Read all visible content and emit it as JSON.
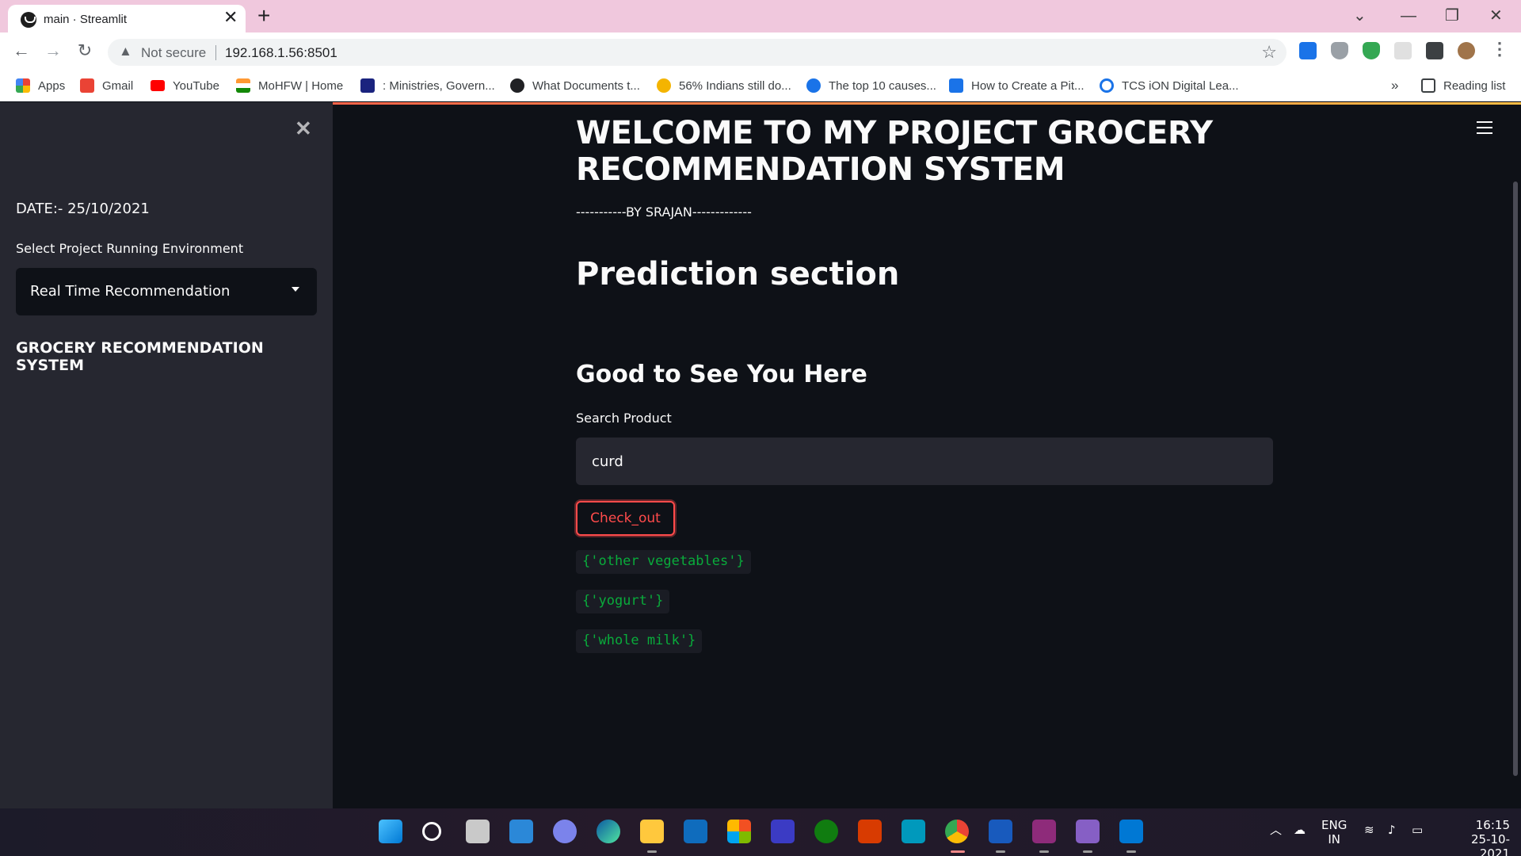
{
  "browser": {
    "tab_title": "main · Streamlit",
    "tab_close": "✕",
    "new_tab": "+",
    "address": {
      "security_label": "Not secure",
      "url": "192.168.1.56:8501"
    },
    "bookmarks": [
      {
        "label": "Apps",
        "icon": "apps-grid-icon",
        "color": "#4285f4"
      },
      {
        "label": "Gmail",
        "icon": "gmail-icon",
        "color": "#ea4335"
      },
      {
        "label": "YouTube",
        "icon": "youtube-icon",
        "color": "#ff0000"
      },
      {
        "label": "MoHFW | Home",
        "icon": "india-flag-icon",
        "color": "#ff9933"
      },
      {
        "label": ": Ministries, Govern...",
        "icon": "s-logo-icon",
        "color": "#1a237e"
      },
      {
        "label": "What Documents t...",
        "icon": "globe-icon",
        "color": "#202124"
      },
      {
        "label": "56% Indians still do...",
        "icon": "site-icon",
        "color": "#f4b400"
      },
      {
        "label": "The top 10 causes...",
        "icon": "site-icon",
        "color": "#1a73e8"
      },
      {
        "label": "How to Create a Pit...",
        "icon": "chart-icon",
        "color": "#1a73e8"
      },
      {
        "label": "TCS iON Digital Lea...",
        "icon": "power-icon",
        "color": "#1a73e8"
      }
    ],
    "bookmarks_more": "»",
    "reading_list": "Reading list"
  },
  "sidebar": {
    "date": "DATE:- 25/10/2021",
    "select_label": "Select Project Running Environment",
    "select_value": "Real Time Recommendation",
    "heading": "GROCERY RECOMMENDATION SYSTEM"
  },
  "main": {
    "title": "WELCOME TO MY PROJECT GROCERY RECOMMENDATION SYSTEM",
    "byline": "-----------BY SRAJAN-------------",
    "section_heading": "Prediction section",
    "subheading": "Good to See You Here",
    "search_label": "Search Product",
    "search_value": "curd",
    "button_label": "Check_out",
    "results": [
      "{'other vegetables'}",
      "{'yogurt'}",
      "{'whole milk'}"
    ]
  },
  "taskbar": {
    "lang_top": "ENG",
    "lang_bottom": "IN",
    "time": "16:15",
    "date": "25-10-2021"
  },
  "colors": {
    "accent": "#ff4b4b",
    "code_text": "#09ab3b",
    "background": "#0e1117",
    "sidebar": "#262730"
  }
}
